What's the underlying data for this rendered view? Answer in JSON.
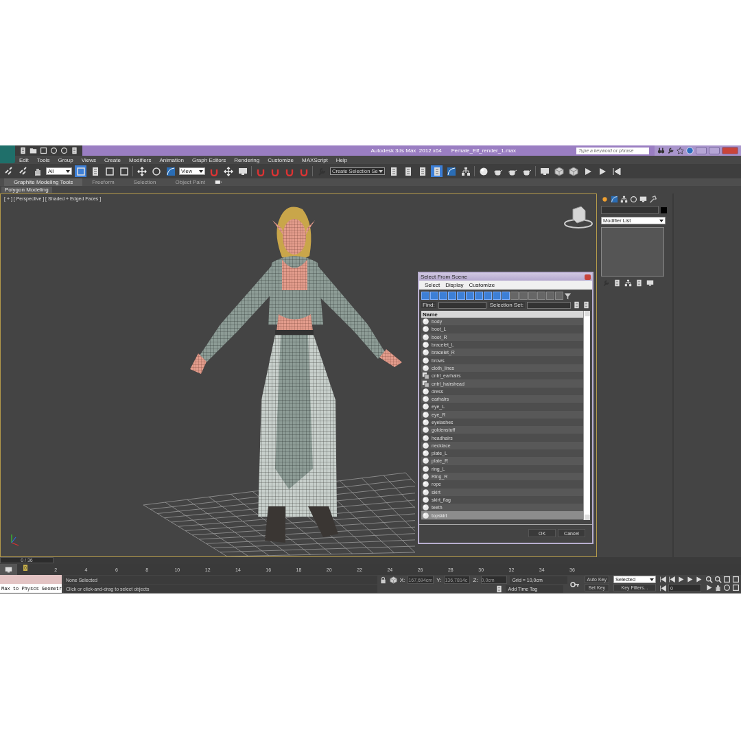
{
  "title_bar": {
    "app_title": "Autodesk 3ds Max  2012 x64",
    "file_name": "Female_Elf_render_1.max",
    "search": {
      "placeholder": "Type a keyword or phrase"
    }
  },
  "menu_bar": [
    "Edit",
    "Tools",
    "Group",
    "Views",
    "Create",
    "Modifiers",
    "Animation",
    "Graph Editors",
    "Rendering",
    "Customize",
    "MAXScript",
    "Help"
  ],
  "main_toolbar": {
    "selection_filter": "All",
    "reference_coord": "View",
    "named_selection": "Create Selection Se"
  },
  "ribbon": {
    "tabs": [
      {
        "label": "Graphite Modeling Tools",
        "selected": true
      },
      {
        "label": "Freeform",
        "selected": false
      },
      {
        "label": "Selection",
        "selected": false
      },
      {
        "label": "Object Paint",
        "selected": false
      }
    ],
    "panel": "Polygon Modeling"
  },
  "viewport": {
    "label": "[ + ] [ Perspective ] [ Shaded + Edged Faces ]"
  },
  "select_dialog": {
    "title": "Select From Scene",
    "menus": [
      "Select",
      "Display",
      "Customize"
    ],
    "find_label": "Find:",
    "selection_set_label": "Selection Set:",
    "column": "Name",
    "objects": [
      {
        "name": "body",
        "kind": "geometry",
        "selected": false
      },
      {
        "name": "boot_L",
        "kind": "geometry",
        "selected": false
      },
      {
        "name": "boot_R",
        "kind": "geometry",
        "selected": false
      },
      {
        "name": "bracelet_L",
        "kind": "geometry",
        "selected": false
      },
      {
        "name": "bracelet_R",
        "kind": "geometry",
        "selected": false
      },
      {
        "name": "brows",
        "kind": "geometry",
        "selected": false
      },
      {
        "name": "cloth_lines",
        "kind": "geometry",
        "selected": false
      },
      {
        "name": "cntrl_earhairs",
        "kind": "group",
        "selected": false
      },
      {
        "name": "cntrl_hairshead",
        "kind": "group",
        "selected": false
      },
      {
        "name": "dress",
        "kind": "geometry",
        "selected": false
      },
      {
        "name": "earhairs",
        "kind": "geometry",
        "selected": false
      },
      {
        "name": "eye_L",
        "kind": "geometry",
        "selected": false
      },
      {
        "name": "eye_R",
        "kind": "geometry",
        "selected": false
      },
      {
        "name": "eyelashes",
        "kind": "geometry",
        "selected": false
      },
      {
        "name": "goldenstuff",
        "kind": "geometry",
        "selected": false
      },
      {
        "name": "headhairs",
        "kind": "geometry",
        "selected": false
      },
      {
        "name": "necklace",
        "kind": "geometry",
        "selected": false
      },
      {
        "name": "plate_L",
        "kind": "geometry",
        "selected": false
      },
      {
        "name": "plate_R",
        "kind": "geometry",
        "selected": false
      },
      {
        "name": "ring_L",
        "kind": "geometry",
        "selected": false
      },
      {
        "name": "Ring_R",
        "kind": "geometry",
        "selected": false
      },
      {
        "name": "rope",
        "kind": "geometry",
        "selected": false
      },
      {
        "name": "skirt",
        "kind": "geometry",
        "selected": false
      },
      {
        "name": "skirt_flag",
        "kind": "geometry",
        "selected": false
      },
      {
        "name": "teeth",
        "kind": "geometry",
        "selected": false
      },
      {
        "name": "topskirt",
        "kind": "geometry",
        "selected": true
      }
    ],
    "buttons": [
      "OK",
      "Cancel"
    ]
  },
  "command_panel": {
    "modifier_list": "Modifier List"
  },
  "time_slider": {
    "position": "0 / 36",
    "level": 0
  },
  "track_bar": {
    "ticks": [
      "0",
      "2",
      "4",
      "6",
      "8",
      "10",
      "12",
      "14",
      "16",
      "18",
      "20",
      "22",
      "24",
      "26",
      "28",
      "30",
      "32",
      "34",
      "36"
    ]
  },
  "status": {
    "listener_output": "Max to Physcs Geometr",
    "selection": "None Selected",
    "prompt": "Click or click-and-drag to select objects",
    "x_label": "X:",
    "x": "167,694cm",
    "y_label": "Y:",
    "y": "136,7814c",
    "z_label": "Z:",
    "z": "0,0cm",
    "grid": "Grid = 10,0cm",
    "time_tag": "Add Time Tag",
    "auto_key": "Auto Key",
    "key_mode": "Selected",
    "set_key": "Set Key",
    "key_filters": "Key Filters...",
    "frame": "0"
  }
}
